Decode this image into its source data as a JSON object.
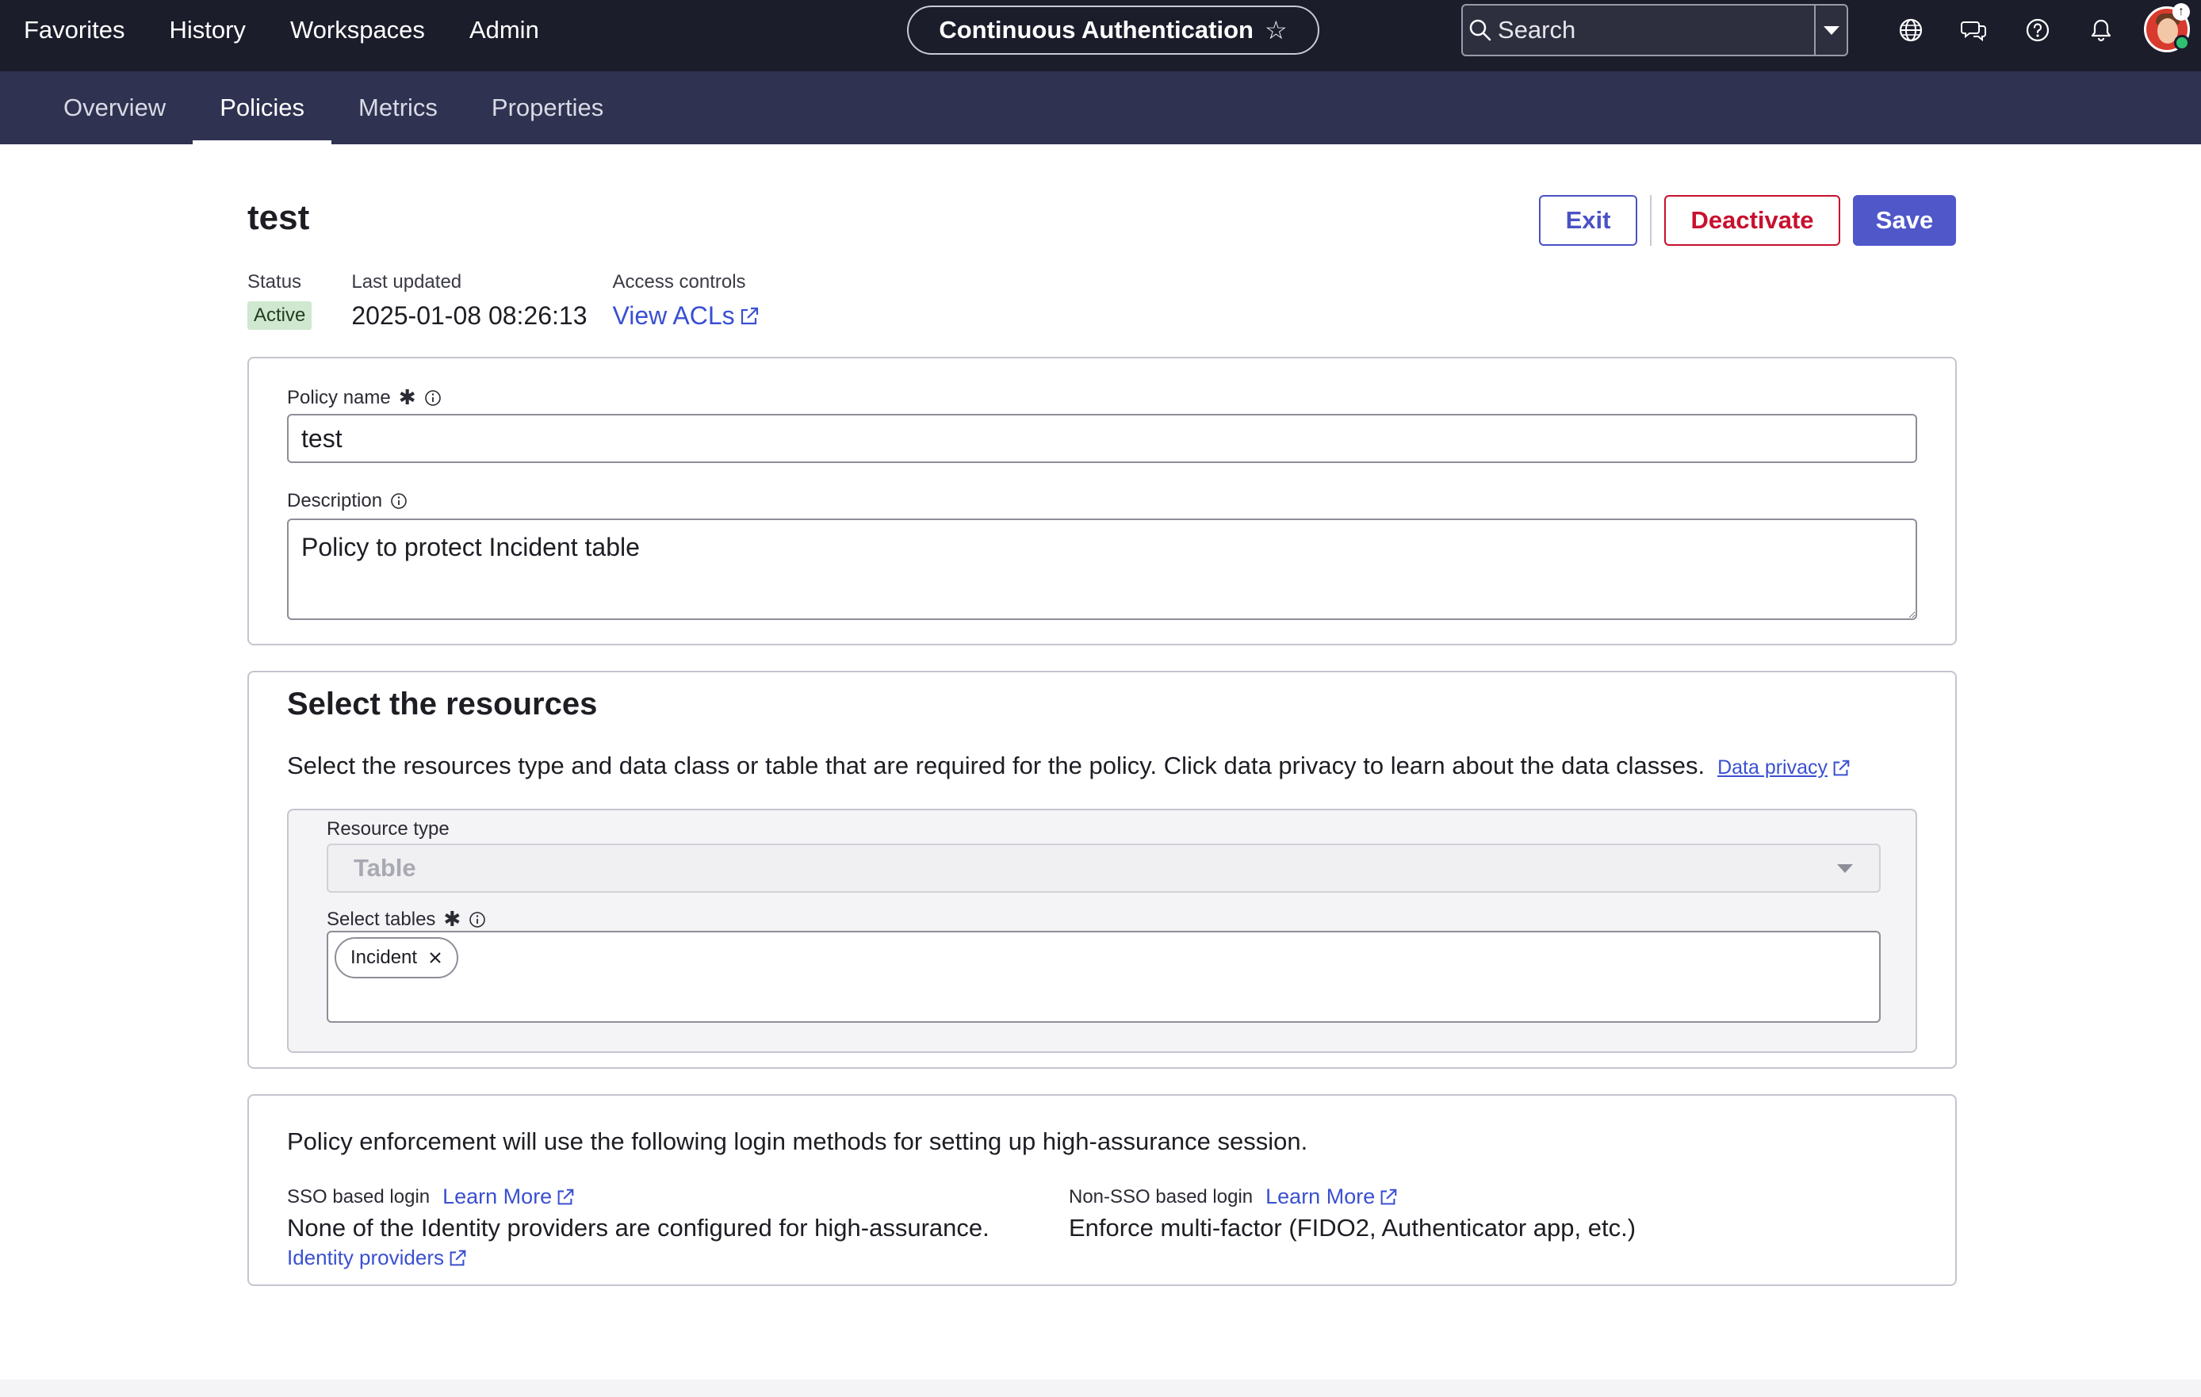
{
  "topbar": {
    "nav": [
      "Favorites",
      "History",
      "Workspaces",
      "Admin"
    ],
    "app_title": "Continuous Authentication",
    "search_placeholder": "Search"
  },
  "subnav": {
    "tabs": [
      "Overview",
      "Policies",
      "Metrics",
      "Properties"
    ],
    "active_tab": "Policies"
  },
  "header": {
    "title": "test",
    "buttons": {
      "exit": "Exit",
      "deactivate": "Deactivate",
      "save": "Save"
    }
  },
  "meta": {
    "status_label": "Status",
    "status_value": "Active",
    "updated_label": "Last updated",
    "updated_value": "2025-01-08 08:26:13",
    "access_label": "Access controls",
    "access_link": "View ACLs"
  },
  "policy_form": {
    "name_label": "Policy name",
    "name_value": "test",
    "description_label": "Description",
    "description_value": "Policy to protect Incident table"
  },
  "resources": {
    "title": "Select the resources",
    "description": "Select the resources type and data class or table that are required for the policy. Click data privacy to learn about the data classes.",
    "privacy_link": "Data privacy",
    "resource_type_label": "Resource type",
    "resource_type_value": "Table",
    "tables_label": "Select tables",
    "tables": [
      "Incident"
    ]
  },
  "enforcement": {
    "heading": "Policy enforcement will use the following login methods for setting up high-assurance session.",
    "sso_label": "SSO based login",
    "sso_learn_more": "Learn More",
    "sso_value": "None of the Identity providers are configured for high-assurance.",
    "sso_link": "Identity providers",
    "non_sso_label": "Non-SSO based login",
    "non_sso_learn_more": "Learn More",
    "non_sso_value": "Enforce multi-factor (FIDO2, Authenticator app, etc.)"
  },
  "colors": {
    "topbar": "#1b1d2b",
    "subnav": "#2f3250",
    "primary": "#4f57c9",
    "danger": "#c8102e",
    "link": "#3a50d0",
    "active_badge": "#cfe8cf"
  }
}
